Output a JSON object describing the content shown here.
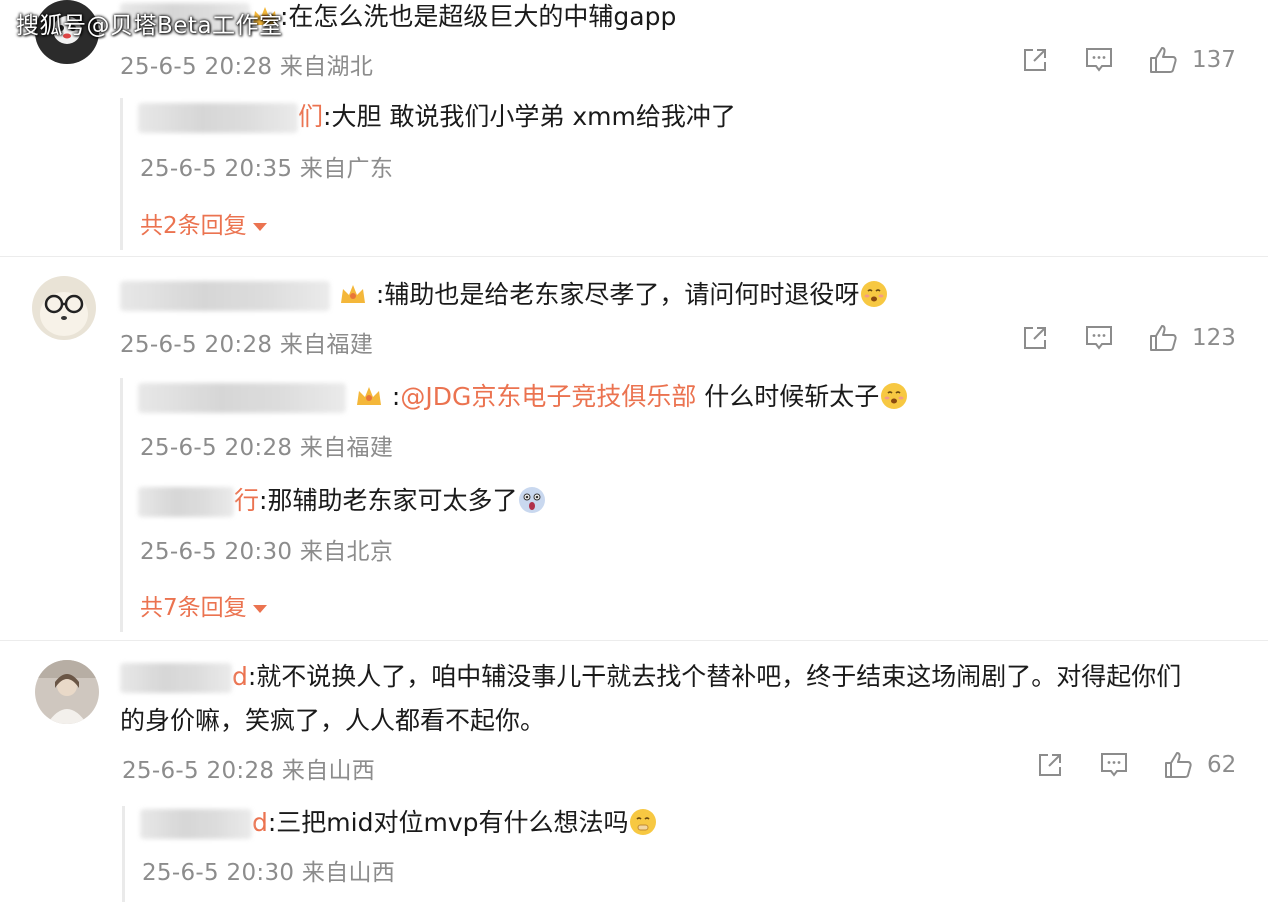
{
  "watermark": "搜狐号@贝塔Beta工作室",
  "comments": [
    {
      "text": ":在怎么洗也是超级巨大的中辅gapp",
      "meta": "25-6-5 20:28 来自湖北",
      "likes": "137",
      "replies": [
        {
          "name_tail": "们",
          "text": ":大胆 敢说我们小学弟 xmm给我冲了",
          "meta": "25-6-5 20:35 来自广东"
        }
      ],
      "more": "共2条回复"
    },
    {
      "text": ":辅助也是给老东家尽孝了，请问何时退役呀",
      "meta": "25-6-5 20:28 来自福建",
      "likes": "123",
      "replies": [
        {
          "mention": "@JDG京东电子竞技俱乐部",
          "text": " 什么时候斩太子",
          "meta": "25-6-5 20:28 来自福建"
        },
        {
          "name_tail": "行",
          "text": ":那辅助老东家可太多了",
          "meta": "25-6-5 20:30 来自北京"
        }
      ],
      "more": "共7条回复"
    },
    {
      "name_tail": "d",
      "text": ":就不说换人了，咱中辅没事儿干就去找个替补吧，终于结束这场闹剧了。对得起你们",
      "text2": "的身价嘛，笑疯了，人人都看不起你。",
      "meta": "25-6-5 20:28 来自山西",
      "likes": "62",
      "replies": [
        {
          "name_tail": "d",
          "text": ":三把mid对位mvp有什么想法吗",
          "meta": "25-6-5 20:30 来自山西"
        }
      ]
    }
  ],
  "icons": {
    "share": "share-icon",
    "comment": "comment-icon",
    "like": "thumbs-up-icon"
  },
  "colors": {
    "accent": "#eb7350",
    "meta": "#8c8c8c",
    "text": "#1a1a1a"
  }
}
